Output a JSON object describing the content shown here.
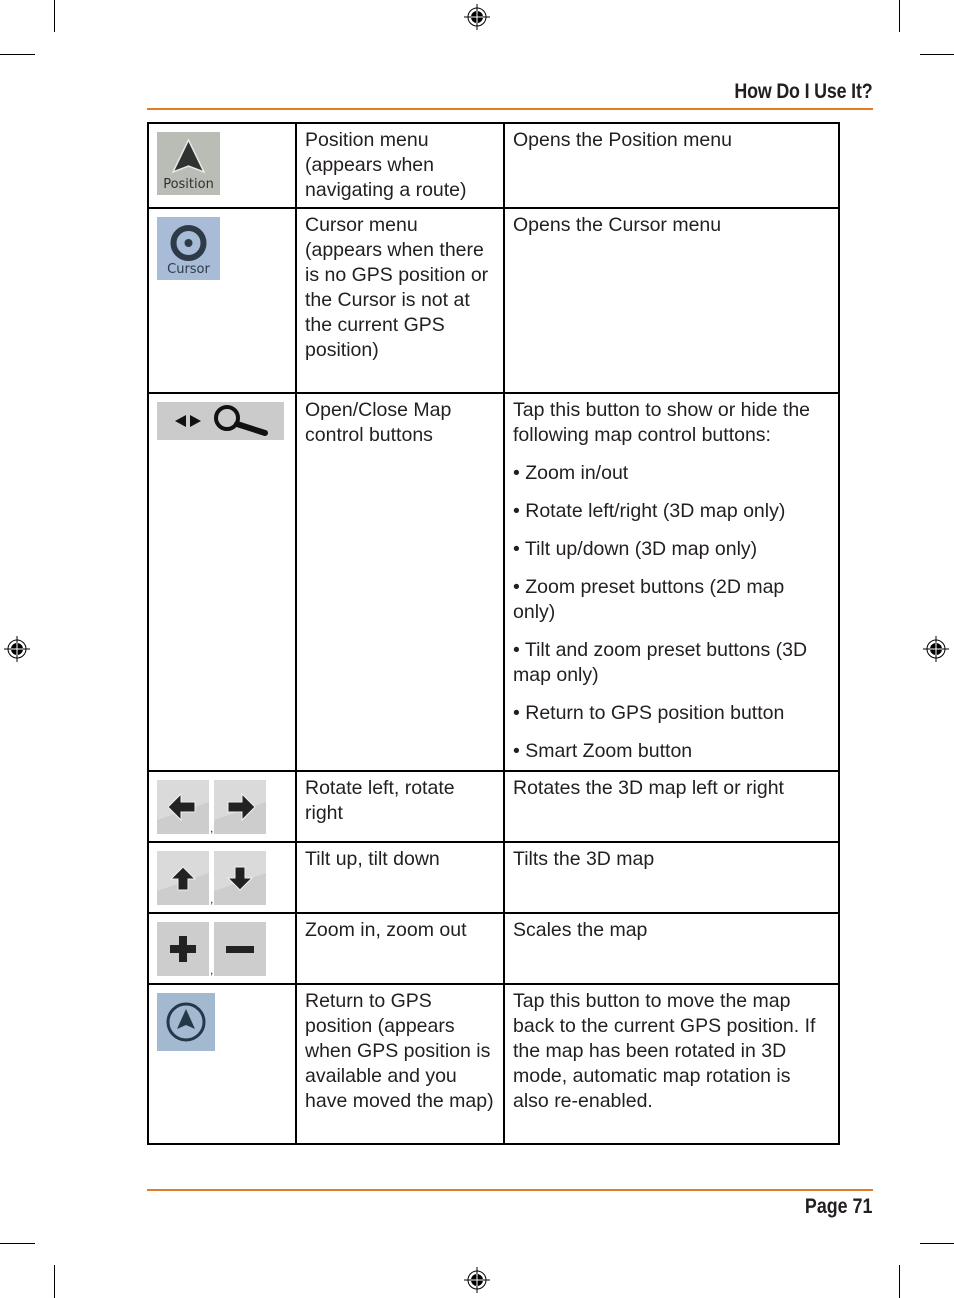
{
  "header": {
    "title": "How Do I Use It?"
  },
  "footer": {
    "page_label": "Page 71"
  },
  "colors": {
    "rule": "#e07b28",
    "text": "#231f20",
    "border": "#000000"
  },
  "rows": [
    {
      "icons": [
        "position-icon"
      ],
      "icon_labels": [
        "Position"
      ],
      "name": "Position menu (appears when navigating a route)",
      "description": [
        "Opens the Position menu"
      ]
    },
    {
      "icons": [
        "cursor-icon"
      ],
      "icon_labels": [
        "Cursor"
      ],
      "name": "Cursor menu (appears when there is no GPS position or the Cursor is not at the current GPS position)",
      "description": [
        "Opens the Cursor menu"
      ]
    },
    {
      "icons": [
        "map-controls-toggle-icon"
      ],
      "name": "Open/Close Map control buttons",
      "description": [
        "Tap this button to show or hide the following map control buttons:",
        "• Zoom in/out",
        "• Rotate left/right (3D map only)",
        "• Tilt up/down (3D map only)",
        "• Zoom preset buttons (2D map only)",
        "• Tilt and zoom preset buttons (3D map only)",
        "• Return to GPS position button",
        "• Smart Zoom button"
      ]
    },
    {
      "icons": [
        "rotate-left-icon",
        "rotate-right-icon"
      ],
      "separator": ",",
      "name": "Rotate left, rotate right",
      "description": [
        "Rotates the 3D map left or right"
      ]
    },
    {
      "icons": [
        "tilt-up-icon",
        "tilt-down-icon"
      ],
      "separator": ",",
      "name": "Tilt up, tilt down",
      "description": [
        "Tilts the 3D map"
      ]
    },
    {
      "icons": [
        "zoom-in-icon",
        "zoom-out-icon"
      ],
      "separator": ",",
      "name": "Zoom in, zoom out",
      "description": [
        "Scales the map"
      ]
    },
    {
      "icons": [
        "return-to-gps-icon"
      ],
      "name": "Return to GPS position (appears when GPS position is available and you have moved the map)",
      "description": [
        "Tap this button to move the map back to the current GPS position. If the map has been rotated in 3D mode, automatic map rotation is also re-enabled."
      ]
    }
  ]
}
